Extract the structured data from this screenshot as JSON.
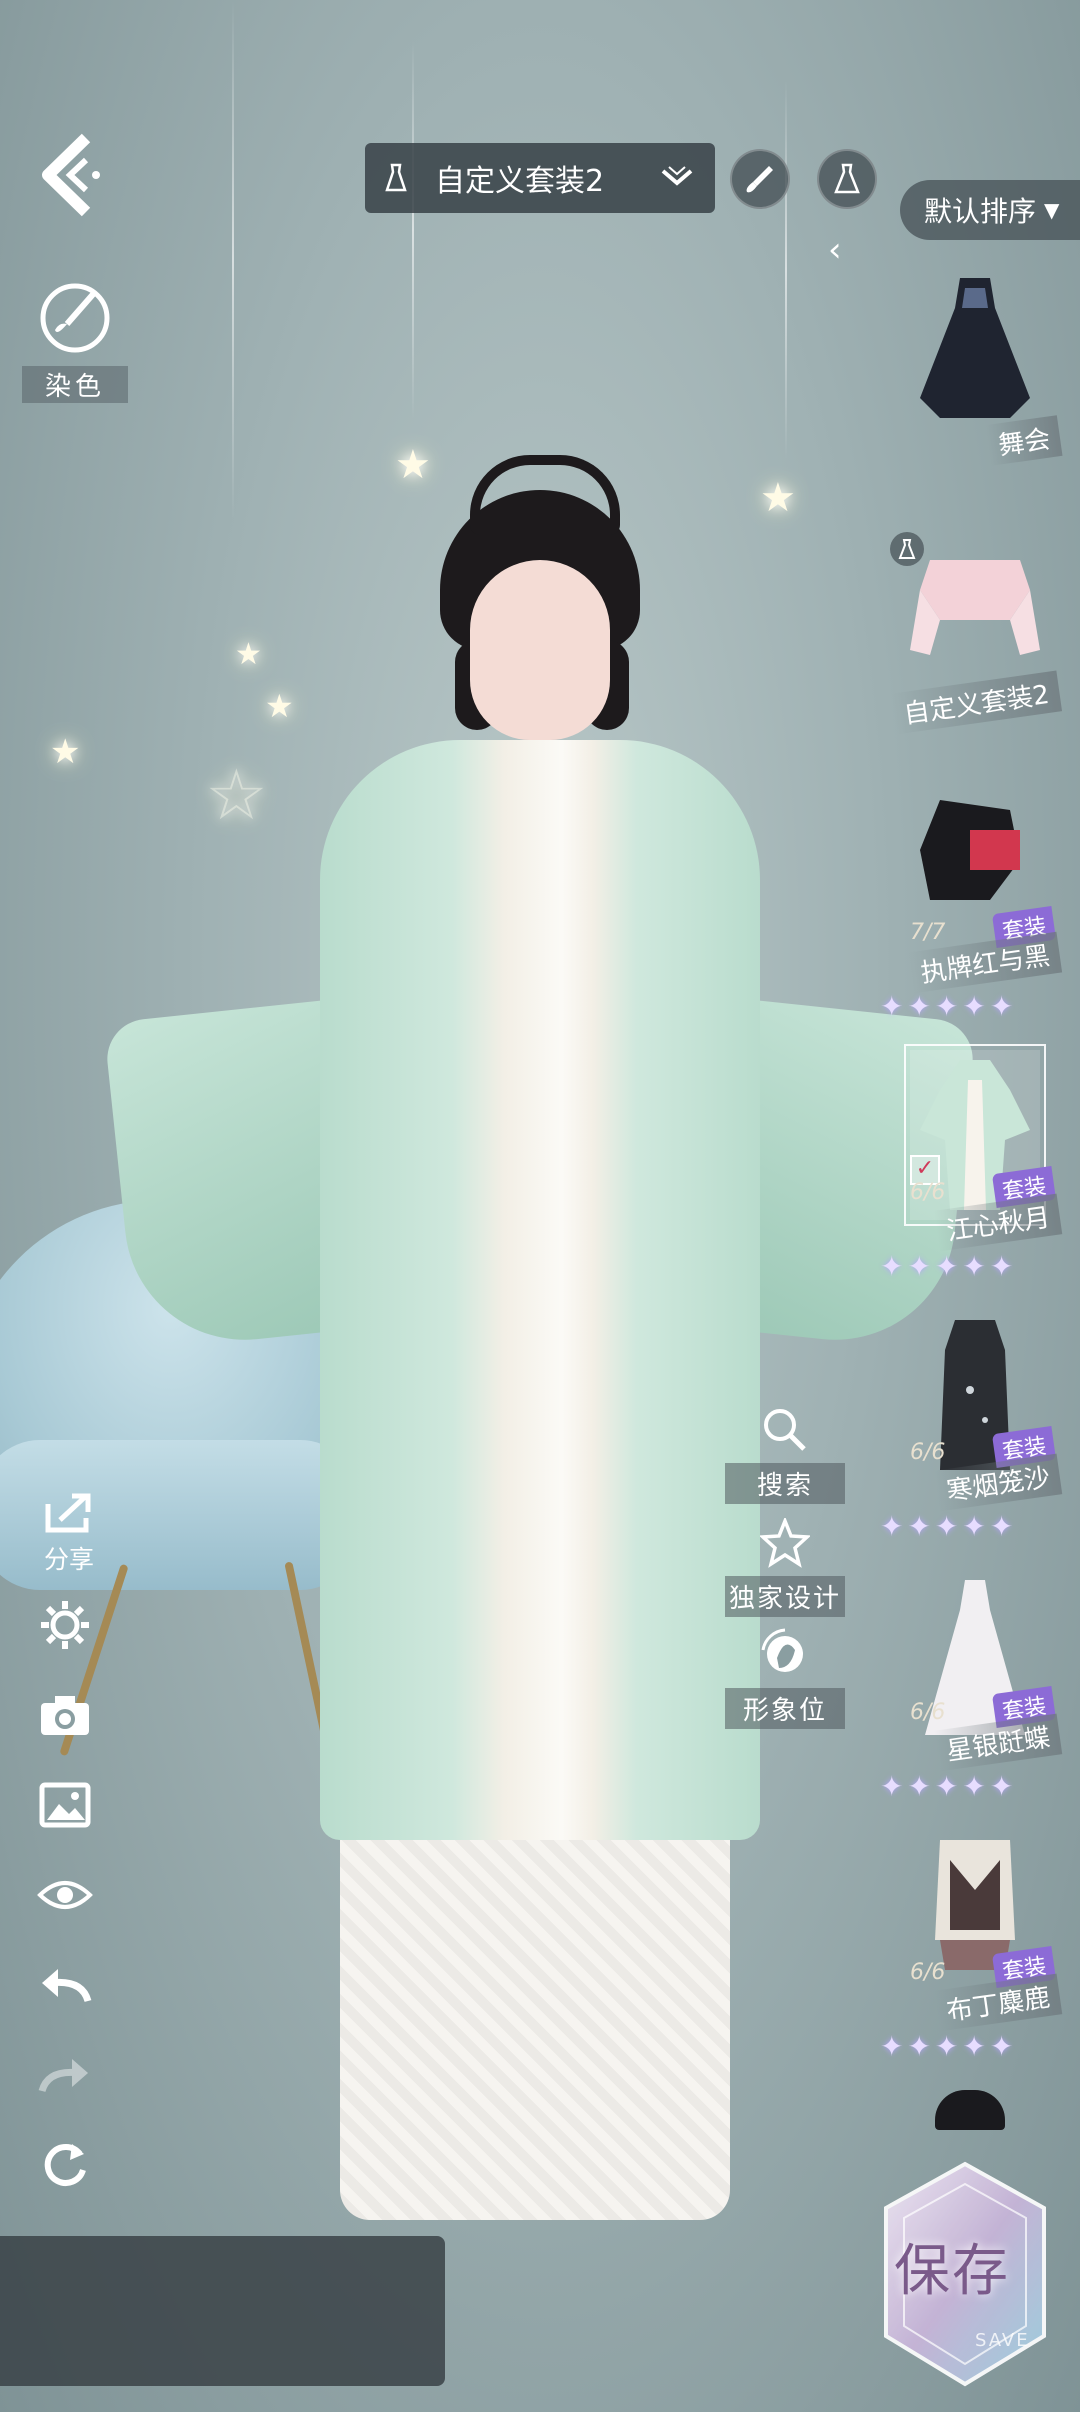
{
  "top_bar": {
    "outfit_name": "自定义套装2"
  },
  "left_tools": {
    "dye_label": "染色",
    "share_label": "分享"
  },
  "sort": {
    "label": "默认排序"
  },
  "quick_actions": {
    "search_label": "搜索",
    "exclusive_label": "独家设计",
    "avatar_label": "形象位"
  },
  "outfits": [
    {
      "name": "舞会",
      "suit": "",
      "count": "",
      "stars": ""
    },
    {
      "name": "自定义套装2",
      "suit": "",
      "count": "",
      "stars": ""
    },
    {
      "name": "执牌红与黑",
      "suit": "套装",
      "count": "7/7",
      "stars": "✦✦✦✦✦"
    },
    {
      "name": "江心秋月",
      "suit": "套装",
      "count": "6/6",
      "stars": "✦✦✦✦✦"
    },
    {
      "name": "寒烟笼沙",
      "suit": "套装",
      "count": "6/6",
      "stars": "✦✦✦✦✦"
    },
    {
      "name": "星银跹蝶",
      "suit": "套装",
      "count": "6/6",
      "stars": "✦✦✦✦✦"
    },
    {
      "name": "布丁麋鹿",
      "suit": "套装",
      "count": "6/6",
      "stars": "✦✦✦✦✦"
    }
  ],
  "save": {
    "label": "保存",
    "sub": "SAVE"
  },
  "colors": {
    "accent": "#8c6bd6",
    "panel": "#3a4246"
  }
}
